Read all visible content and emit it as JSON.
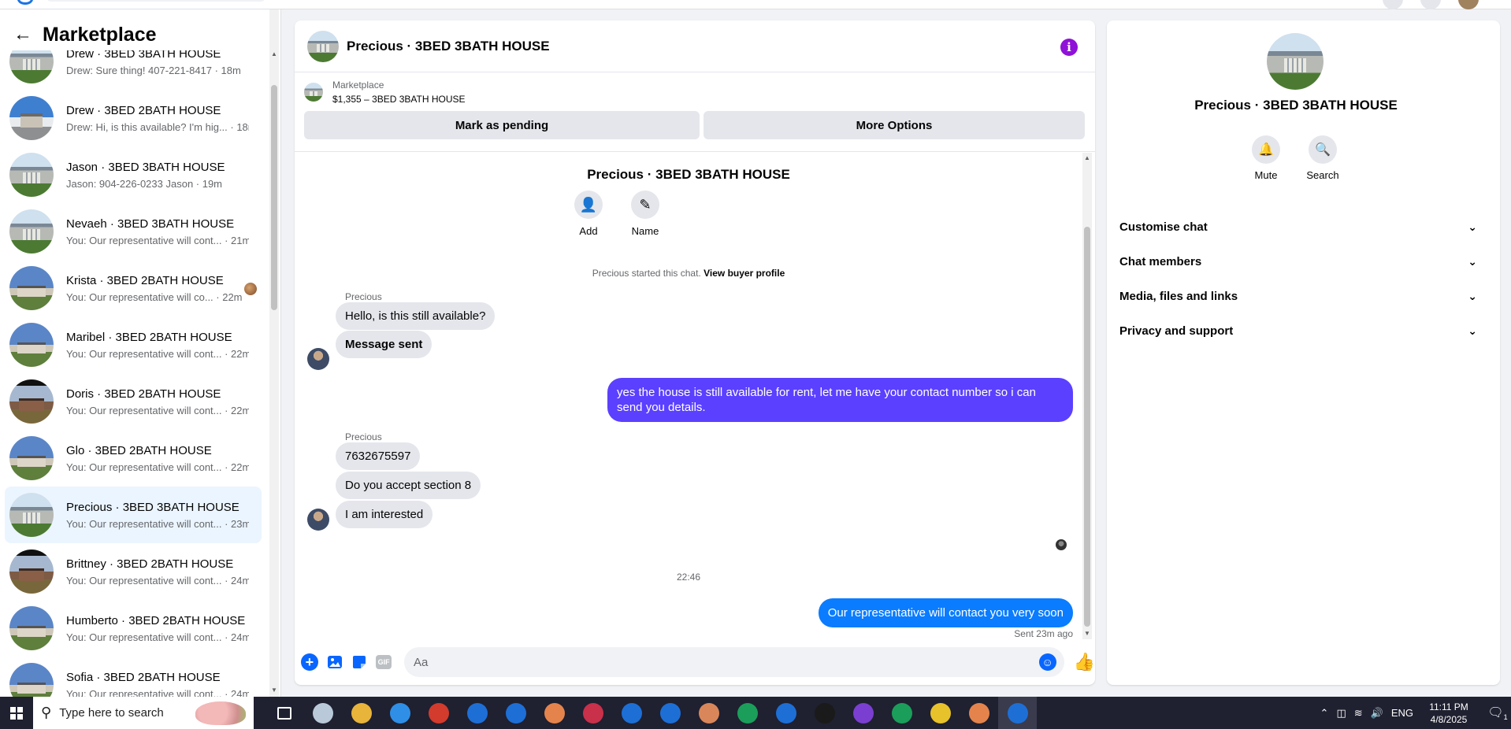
{
  "sidebar": {
    "title": "Marketplace",
    "conversations": [
      {
        "name": "Drew · 3BED 3BATH HOUSE",
        "preview": "Drew: Sure thing! 407-221-8417 · 18m",
        "thumb": "house-a"
      },
      {
        "name": "Drew · 3BED 2BATH HOUSE",
        "preview": "Drew: Hi, is this available? I'm hig... · 18m",
        "thumb": "house-b"
      },
      {
        "name": "Jason · 3BED 3BATH HOUSE",
        "preview": "Jason: 904-226-0233 Jason · 19m",
        "thumb": "house-a"
      },
      {
        "name": "Nevaeh · 3BED 3BATH HOUSE",
        "preview": "You: Our representative will cont... · 21m",
        "thumb": "house-a"
      },
      {
        "name": "Krista · 3BED 2BATH HOUSE",
        "preview": "You: Our representative will co... · 22m",
        "thumb": "house-c"
      },
      {
        "name": "Maribel · 3BED 2BATH HOUSE",
        "preview": "You: Our representative will cont... · 22m",
        "thumb": "house-c"
      },
      {
        "name": "Doris · 3BED 2BATH HOUSE",
        "preview": "You: Our representative will cont... · 22m",
        "thumb": "house-d"
      },
      {
        "name": "Glo · 3BED 2BATH HOUSE",
        "preview": "You: Our representative will cont... · 22m",
        "thumb": "house-c"
      },
      {
        "name": "Precious · 3BED 3BATH HOUSE",
        "preview": "You: Our representative will cont... · 23m",
        "thumb": "house-a"
      },
      {
        "name": "Brittney · 3BED 2BATH HOUSE",
        "preview": "You: Our representative will cont... · 24m",
        "thumb": "house-d"
      },
      {
        "name": "Humberto · 3BED 2BATH HOUSE",
        "preview": "You: Our representative will cont... · 24m",
        "thumb": "house-c"
      },
      {
        "name": "Sofia · 3BED 2BATH HOUSE",
        "preview": "You: Our representative will cont... · 24m",
        "thumb": "house-c"
      }
    ]
  },
  "chat": {
    "title": "Precious · 3BED 3BATH HOUSE",
    "marketplace_label": "Marketplace",
    "listing": "$1,355 – 3BED 3BATH HOUSE",
    "mark_pending": "Mark as pending",
    "more_options": "More Options",
    "group_title": "Precious · 3BED 3BATH HOUSE",
    "add_label": "Add",
    "name_label": "Name",
    "started_text": "Precious started this chat.",
    "buyer_profile": "View buyer profile",
    "sender_name": "Precious",
    "messages": {
      "m1": "Hello, is this still available?",
      "m2": "Message sent",
      "m3": "yes the house is still available for rent, let me have your contact number so i can send you details.",
      "m4": "7632675597",
      "m5": "Do you accept section 8",
      "m6": "I am interested",
      "m7": "Our representative will contact you very soon"
    },
    "time_separator": "22:46",
    "sent_status": "Sent 23m ago",
    "input_placeholder": "Aa"
  },
  "info_panel": {
    "name": "Precious · 3BED 3BATH HOUSE",
    "mute": "Mute",
    "search": "Search",
    "sections": [
      "Customise chat",
      "Chat members",
      "Media, files and links",
      "Privacy and support"
    ]
  },
  "taskbar": {
    "search_placeholder": "Type here to search",
    "lang": "ENG",
    "time": "11:11 PM",
    "date": "4/8/2025",
    "notifications": "1",
    "app_colors": [
      "#b9c9da",
      "#e8b43a",
      "#2f8fe6",
      "#d33b2c",
      "#1d6fd6",
      "#1d6fd6",
      "#e4844c",
      "#c9304a",
      "#1d6fd6",
      "#1d6fd6",
      "#d9875a",
      "#1b9e5a",
      "#1d6fd6",
      "#1a1a1a",
      "#7a3fd0",
      "#1b9e5a",
      "#e8c22a",
      "#e4844c",
      "#1d6fd6"
    ]
  },
  "colors": {
    "accent": "#0866ff",
    "outgoing_purple": "#5b40ff",
    "outgoing_blue": "#0a7cff",
    "info_icon": "#8f12d8",
    "active_row": "#ebf5ff"
  }
}
